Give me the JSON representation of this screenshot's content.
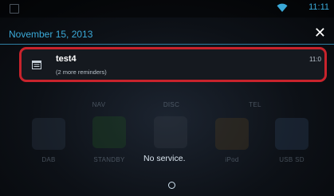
{
  "status_bar": {
    "clock": "11:11",
    "left_icon": "notification-icon",
    "wifi_icon": "wifi-icon"
  },
  "notification_panel": {
    "date": "November 15, 2013",
    "close_icon": "close-icon",
    "items": [
      {
        "icon": "calendar-icon",
        "title": "test4",
        "subtitle": "(2 more reminders)",
        "time": "11:0"
      }
    ]
  },
  "home_screen": {
    "row1": [
      "NAV",
      "DISC",
      "TEL"
    ],
    "row2": [
      "DAB",
      "STANDBY",
      "iPod",
      "USB SD"
    ]
  },
  "status_message": "No service.",
  "colors": {
    "accent": "#3aa9d8",
    "highlight_border": "#c8232c"
  }
}
